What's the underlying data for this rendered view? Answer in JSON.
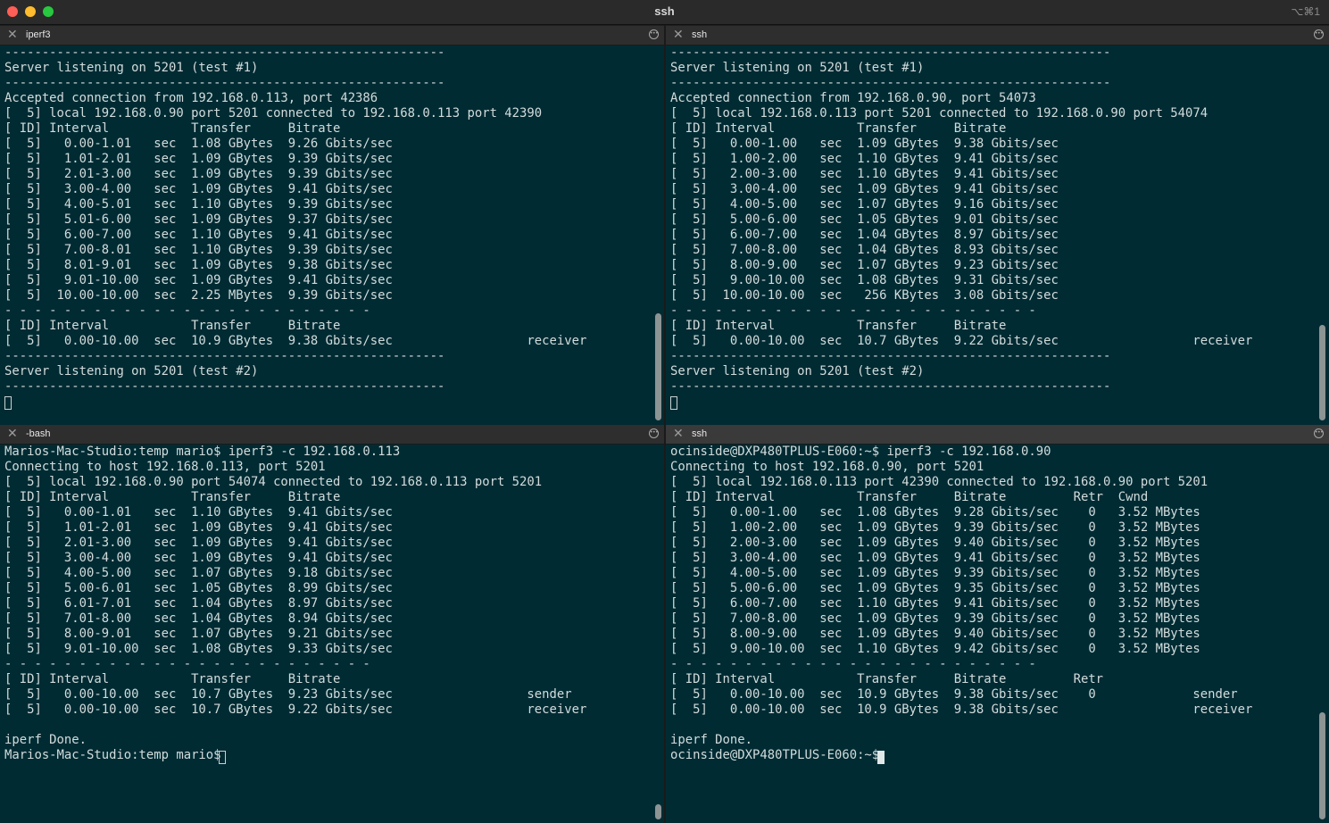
{
  "window": {
    "title": "ssh",
    "shortcut": "⌥⌘1"
  },
  "panes": {
    "top_left": {
      "tab_title": "iperf3",
      "lines": [
        "-----------------------------------------------------------",
        "Server listening on 5201 (test #1)",
        "-----------------------------------------------------------",
        "Accepted connection from 192.168.0.113, port 42386",
        "[  5] local 192.168.0.90 port 5201 connected to 192.168.0.113 port 42390",
        "[ ID] Interval           Transfer     Bitrate",
        "[  5]   0.00-1.01   sec  1.08 GBytes  9.26 Gbits/sec",
        "[  5]   1.01-2.01   sec  1.09 GBytes  9.39 Gbits/sec",
        "[  5]   2.01-3.00   sec  1.09 GBytes  9.39 Gbits/sec",
        "[  5]   3.00-4.00   sec  1.09 GBytes  9.41 Gbits/sec",
        "[  5]   4.00-5.01   sec  1.10 GBytes  9.39 Gbits/sec",
        "[  5]   5.01-6.00   sec  1.09 GBytes  9.37 Gbits/sec",
        "[  5]   6.00-7.00   sec  1.10 GBytes  9.41 Gbits/sec",
        "[  5]   7.00-8.01   sec  1.10 GBytes  9.39 Gbits/sec",
        "[  5]   8.01-9.01   sec  1.09 GBytes  9.38 Gbits/sec",
        "[  5]   9.01-10.00  sec  1.09 GBytes  9.41 Gbits/sec",
        "[  5]  10.00-10.00  sec  2.25 MBytes  9.39 Gbits/sec",
        "- - - - - - - - - - - - - - - - - - - - - - - - -",
        "[ ID] Interval           Transfer     Bitrate",
        "[  5]   0.00-10.00  sec  10.9 GBytes  9.38 Gbits/sec                  receiver",
        "-----------------------------------------------------------",
        "Server listening on 5201 (test #2)",
        "-----------------------------------------------------------"
      ]
    },
    "top_right": {
      "tab_title": "ssh",
      "lines": [
        "-----------------------------------------------------------",
        "Server listening on 5201 (test #1)",
        "-----------------------------------------------------------",
        "Accepted connection from 192.168.0.90, port 54073",
        "[  5] local 192.168.0.113 port 5201 connected to 192.168.0.90 port 54074",
        "[ ID] Interval           Transfer     Bitrate",
        "[  5]   0.00-1.00   sec  1.09 GBytes  9.38 Gbits/sec",
        "[  5]   1.00-2.00   sec  1.10 GBytes  9.41 Gbits/sec",
        "[  5]   2.00-3.00   sec  1.10 GBytes  9.41 Gbits/sec",
        "[  5]   3.00-4.00   sec  1.09 GBytes  9.41 Gbits/sec",
        "[  5]   4.00-5.00   sec  1.07 GBytes  9.16 Gbits/sec",
        "[  5]   5.00-6.00   sec  1.05 GBytes  9.01 Gbits/sec",
        "[  5]   6.00-7.00   sec  1.04 GBytes  8.97 Gbits/sec",
        "[  5]   7.00-8.00   sec  1.04 GBytes  8.93 Gbits/sec",
        "[  5]   8.00-9.00   sec  1.07 GBytes  9.23 Gbits/sec",
        "[  5]   9.00-10.00  sec  1.08 GBytes  9.31 Gbits/sec",
        "[  5]  10.00-10.00  sec   256 KBytes  3.08 Gbits/sec",
        "- - - - - - - - - - - - - - - - - - - - - - - - -",
        "[ ID] Interval           Transfer     Bitrate",
        "[  5]   0.00-10.00  sec  10.7 GBytes  9.22 Gbits/sec                  receiver",
        "-----------------------------------------------------------",
        "Server listening on 5201 (test #2)",
        "-----------------------------------------------------------"
      ]
    },
    "bottom_left": {
      "tab_title": "-bash",
      "lines": [
        "Marios-Mac-Studio:temp mario$ iperf3 -c 192.168.0.113",
        "Connecting to host 192.168.0.113, port 5201",
        "[  5] local 192.168.0.90 port 54074 connected to 192.168.0.113 port 5201",
        "[ ID] Interval           Transfer     Bitrate",
        "[  5]   0.00-1.01   sec  1.10 GBytes  9.41 Gbits/sec",
        "[  5]   1.01-2.01   sec  1.09 GBytes  9.41 Gbits/sec",
        "[  5]   2.01-3.00   sec  1.09 GBytes  9.41 Gbits/sec",
        "[  5]   3.00-4.00   sec  1.09 GBytes  9.41 Gbits/sec",
        "[  5]   4.00-5.00   sec  1.07 GBytes  9.18 Gbits/sec",
        "[  5]   5.00-6.01   sec  1.05 GBytes  8.99 Gbits/sec",
        "[  5]   6.01-7.01   sec  1.04 GBytes  8.97 Gbits/sec",
        "[  5]   7.01-8.00   sec  1.04 GBytes  8.94 Gbits/sec",
        "[  5]   8.00-9.01   sec  1.07 GBytes  9.21 Gbits/sec",
        "[  5]   9.01-10.00  sec  1.08 GBytes  9.33 Gbits/sec",
        "- - - - - - - - - - - - - - - - - - - - - - - - -",
        "[ ID] Interval           Transfer     Bitrate",
        "[  5]   0.00-10.00  sec  10.7 GBytes  9.23 Gbits/sec                  sender",
        "[  5]   0.00-10.00  sec  10.7 GBytes  9.22 Gbits/sec                  receiver",
        "",
        "iperf Done.",
        "Marios-Mac-Studio:temp mario$ "
      ]
    },
    "bottom_right": {
      "tab_title": "ssh",
      "lines": [
        "ocinside@DXP480TPLUS-E060:~$ iperf3 -c 192.168.0.90",
        "Connecting to host 192.168.0.90, port 5201",
        "[  5] local 192.168.0.113 port 42390 connected to 192.168.0.90 port 5201",
        "[ ID] Interval           Transfer     Bitrate         Retr  Cwnd",
        "[  5]   0.00-1.00   sec  1.08 GBytes  9.28 Gbits/sec    0   3.52 MBytes",
        "[  5]   1.00-2.00   sec  1.09 GBytes  9.39 Gbits/sec    0   3.52 MBytes",
        "[  5]   2.00-3.00   sec  1.09 GBytes  9.40 Gbits/sec    0   3.52 MBytes",
        "[  5]   3.00-4.00   sec  1.09 GBytes  9.41 Gbits/sec    0   3.52 MBytes",
        "[  5]   4.00-5.00   sec  1.09 GBytes  9.39 Gbits/sec    0   3.52 MBytes",
        "[  5]   5.00-6.00   sec  1.09 GBytes  9.35 Gbits/sec    0   3.52 MBytes",
        "[  5]   6.00-7.00   sec  1.10 GBytes  9.41 Gbits/sec    0   3.52 MBytes",
        "[  5]   7.00-8.00   sec  1.09 GBytes  9.39 Gbits/sec    0   3.52 MBytes",
        "[  5]   8.00-9.00   sec  1.09 GBytes  9.40 Gbits/sec    0   3.52 MBytes",
        "[  5]   9.00-10.00  sec  1.10 GBytes  9.42 Gbits/sec    0   3.52 MBytes",
        "- - - - - - - - - - - - - - - - - - - - - - - - -",
        "[ ID] Interval           Transfer     Bitrate         Retr",
        "[  5]   0.00-10.00  sec  10.9 GBytes  9.38 Gbits/sec    0             sender",
        "[  5]   0.00-10.00  sec  10.9 GBytes  9.38 Gbits/sec                  receiver",
        "",
        "iperf Done.",
        "ocinside@DXP480TPLUS-E060:~$ "
      ]
    }
  }
}
